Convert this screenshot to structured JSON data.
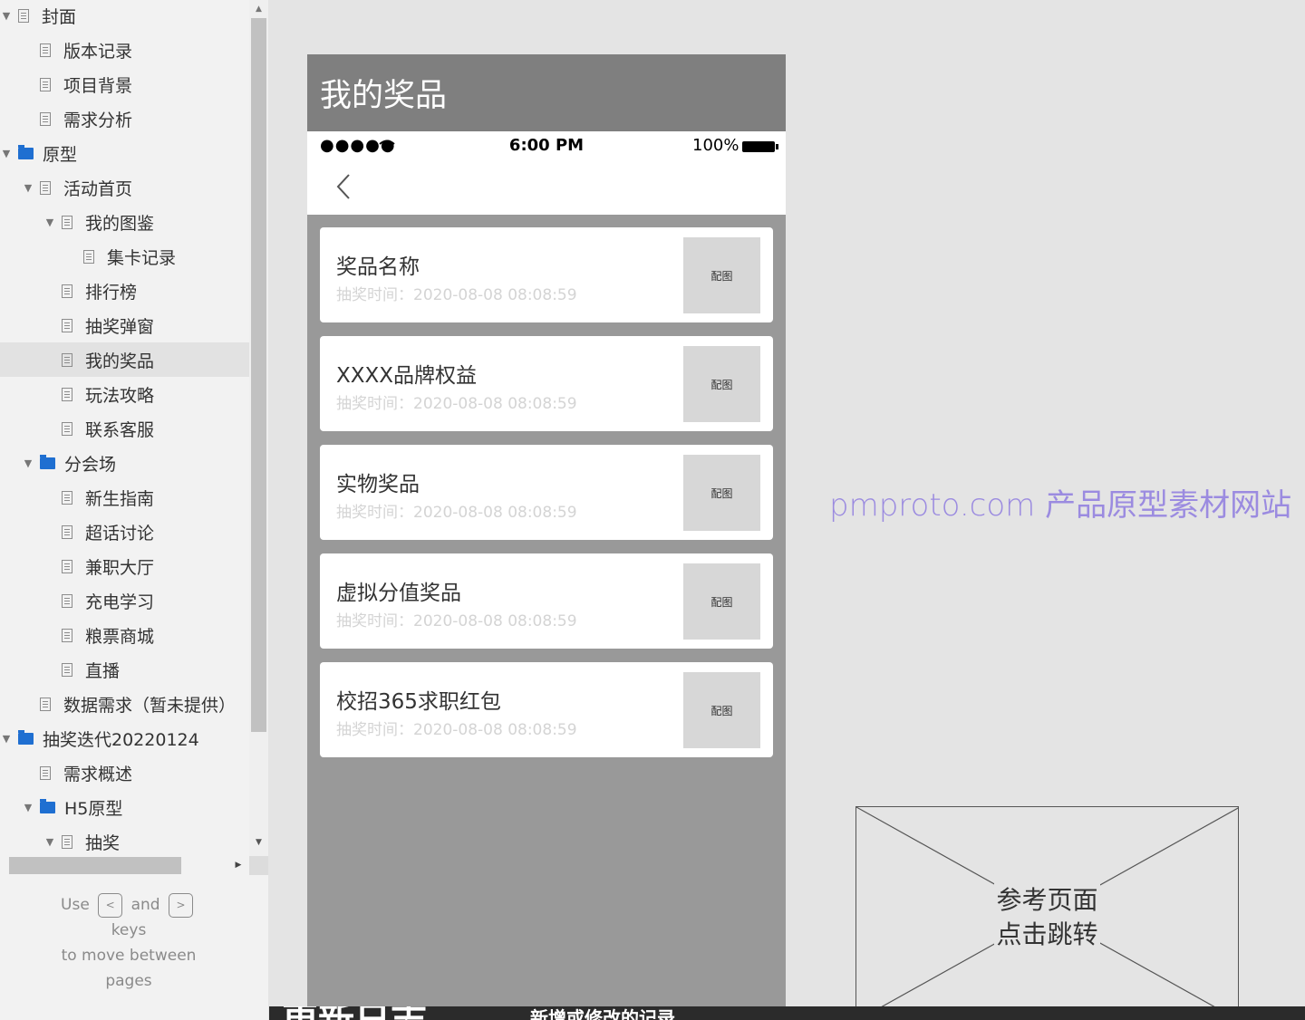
{
  "sidebar": {
    "tree": [
      {
        "label": "封面",
        "depth": 0,
        "type": "page",
        "caret": "down",
        "selected": false
      },
      {
        "label": "版本记录",
        "depth": 1,
        "type": "page",
        "caret": "none",
        "selected": false
      },
      {
        "label": "项目背景",
        "depth": 1,
        "type": "page",
        "caret": "none",
        "selected": false
      },
      {
        "label": "需求分析",
        "depth": 1,
        "type": "page",
        "caret": "none",
        "selected": false
      },
      {
        "label": "原型",
        "depth": 0,
        "type": "folder",
        "caret": "down",
        "selected": false
      },
      {
        "label": "活动首页",
        "depth": 1,
        "type": "page",
        "caret": "down",
        "selected": false
      },
      {
        "label": "我的图鉴",
        "depth": 2,
        "type": "page",
        "caret": "down",
        "selected": false
      },
      {
        "label": "集卡记录",
        "depth": 3,
        "type": "page",
        "caret": "none",
        "selected": false
      },
      {
        "label": "排行榜",
        "depth": 2,
        "type": "page",
        "caret": "none",
        "selected": false
      },
      {
        "label": "抽奖弹窗",
        "depth": 2,
        "type": "page",
        "caret": "none",
        "selected": false
      },
      {
        "label": "我的奖品",
        "depth": 2,
        "type": "page",
        "caret": "none",
        "selected": true
      },
      {
        "label": "玩法攻略",
        "depth": 2,
        "type": "page",
        "caret": "none",
        "selected": false
      },
      {
        "label": "联系客服",
        "depth": 2,
        "type": "page",
        "caret": "none",
        "selected": false
      },
      {
        "label": "分会场",
        "depth": 1,
        "type": "folder",
        "caret": "down",
        "selected": false
      },
      {
        "label": "新生指南",
        "depth": 2,
        "type": "page",
        "caret": "none",
        "selected": false
      },
      {
        "label": "超话讨论",
        "depth": 2,
        "type": "page",
        "caret": "none",
        "selected": false
      },
      {
        "label": "兼职大厅",
        "depth": 2,
        "type": "page",
        "caret": "none",
        "selected": false
      },
      {
        "label": "充电学习",
        "depth": 2,
        "type": "page",
        "caret": "none",
        "selected": false
      },
      {
        "label": "粮票商城",
        "depth": 2,
        "type": "page",
        "caret": "none",
        "selected": false
      },
      {
        "label": "直播",
        "depth": 2,
        "type": "page",
        "caret": "none",
        "selected": false
      },
      {
        "label": "数据需求（暂未提供）",
        "depth": 1,
        "type": "page",
        "caret": "none",
        "selected": false
      },
      {
        "label": "抽奖迭代20220124",
        "depth": 0,
        "type": "folder",
        "caret": "down",
        "selected": false
      },
      {
        "label": "需求概述",
        "depth": 1,
        "type": "page",
        "caret": "none",
        "selected": false
      },
      {
        "label": "H5原型",
        "depth": 1,
        "type": "folder",
        "caret": "down",
        "selected": false
      },
      {
        "label": "抽奖",
        "depth": 2,
        "type": "page",
        "caret": "down",
        "selected": false
      }
    ],
    "hint": {
      "use": "Use",
      "prev_key": "<",
      "and": "and",
      "next_key": ">",
      "keys": "keys",
      "line3": "to move between",
      "line4": "pages"
    }
  },
  "phone": {
    "title": "我的奖品",
    "status": {
      "signal": "●●●●●",
      "time": "6:00 PM",
      "battery": "100%"
    },
    "prizes": [
      {
        "name": "奖品名称",
        "meta": "抽奖时间：2020-08-08 08:08:59",
        "image_label": "配图"
      },
      {
        "name": "XXXX品牌权益",
        "meta": "抽奖时间：2020-08-08 08:08:59",
        "image_label": "配图"
      },
      {
        "name": "实物奖品",
        "meta": "抽奖时间：2020-08-08 08:08:59",
        "image_label": "配图"
      },
      {
        "name": "虚拟分值奖品",
        "meta": "抽奖时间：2020-08-08 08:08:59",
        "image_label": "配图"
      },
      {
        "name": "校招365求职红包",
        "meta": "抽奖时间：2020-08-08 08:08:59",
        "image_label": "配图"
      }
    ]
  },
  "watermark": "pmproto.com 产品原型素材网站",
  "reference": {
    "line1": "参考页面",
    "line2": "点击跳转"
  },
  "bottom": {
    "left": "更新日志",
    "mid": "新增或修改的记录"
  },
  "colors": {
    "folder": "#1f6fd1",
    "selected_row": "#e2e2e2",
    "phone_bg": "#999999",
    "title_bar": "#7f7f7f",
    "watermark": "#9b8be0"
  }
}
